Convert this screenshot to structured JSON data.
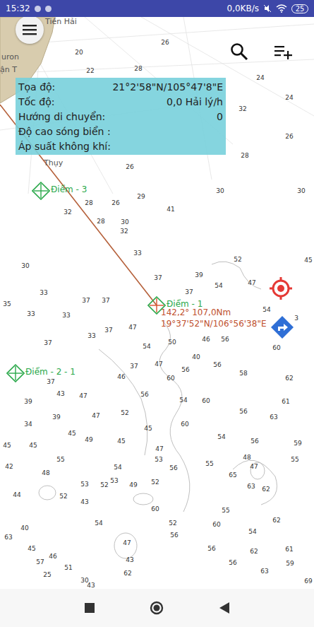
{
  "status_bar": {
    "time": "15:32",
    "speed": "0,0KB/s",
    "battery": "25"
  },
  "land_labels": [
    "Tiền Hải",
    "uron",
    "ận T",
    "Thụy"
  ],
  "info_panel": {
    "rows": [
      {
        "label": "Tọa độ:",
        "value": "21°2'58\"N/105°47'8\"E"
      },
      {
        "label": "Tốc độ:",
        "value": "0,0 Hải lý/h"
      },
      {
        "label": "Hướng di chuyển:",
        "value": "0"
      },
      {
        "label": "Độ cao sóng biển :"
      },
      {
        "label": "Áp suất không khí:"
      }
    ]
  },
  "waypoints": [
    {
      "label": "Điểm - 3",
      "active": false
    },
    {
      "label": "Điểm - 1",
      "active": true
    },
    {
      "label": "Điểm - 2 - 1",
      "active": false
    }
  ],
  "route": {
    "bearing_distance": "142,2° 107,0Nm",
    "position": "19°37'52\"N/106°56'38\"E"
  },
  "soundings": [
    "20",
    "22",
    "28",
    "26",
    "24",
    "24",
    "32",
    "26",
    "28",
    "26",
    "30",
    "30",
    "28",
    "26",
    "29",
    "41",
    "32",
    "28",
    "30",
    "32",
    "33",
    "30",
    "33",
    "35",
    "37",
    "37",
    "37",
    "39",
    "52",
    "45",
    "37",
    "54",
    "47",
    "54",
    "3",
    "33",
    "33",
    "33",
    "37",
    "47",
    "54",
    "50",
    "46",
    "56",
    "60",
    "37",
    "37",
    "46",
    "37",
    "47",
    "40",
    "60",
    "56",
    "56",
    "58",
    "62",
    "56",
    "39",
    "43",
    "47",
    "47",
    "52",
    "54",
    "60",
    "56",
    "61",
    "34",
    "39",
    "45",
    "63",
    "45",
    "45",
    "55",
    "49",
    "45",
    "45",
    "60",
    "54",
    "47",
    "53",
    "53",
    "54",
    "56",
    "55",
    "56",
    "59",
    "47",
    "55",
    "65",
    "42",
    "48",
    "52",
    "49",
    "52",
    "63",
    "62",
    "48",
    "44",
    "52",
    "43",
    "53",
    "62",
    "55",
    "54",
    "60",
    "47",
    "52",
    "43",
    "56",
    "56",
    "62",
    "60",
    "63",
    "40",
    "45",
    "57",
    "46",
    "51",
    "43",
    "30",
    "62",
    "25",
    "69",
    "59",
    "63",
    "56",
    "54",
    "61"
  ]
}
